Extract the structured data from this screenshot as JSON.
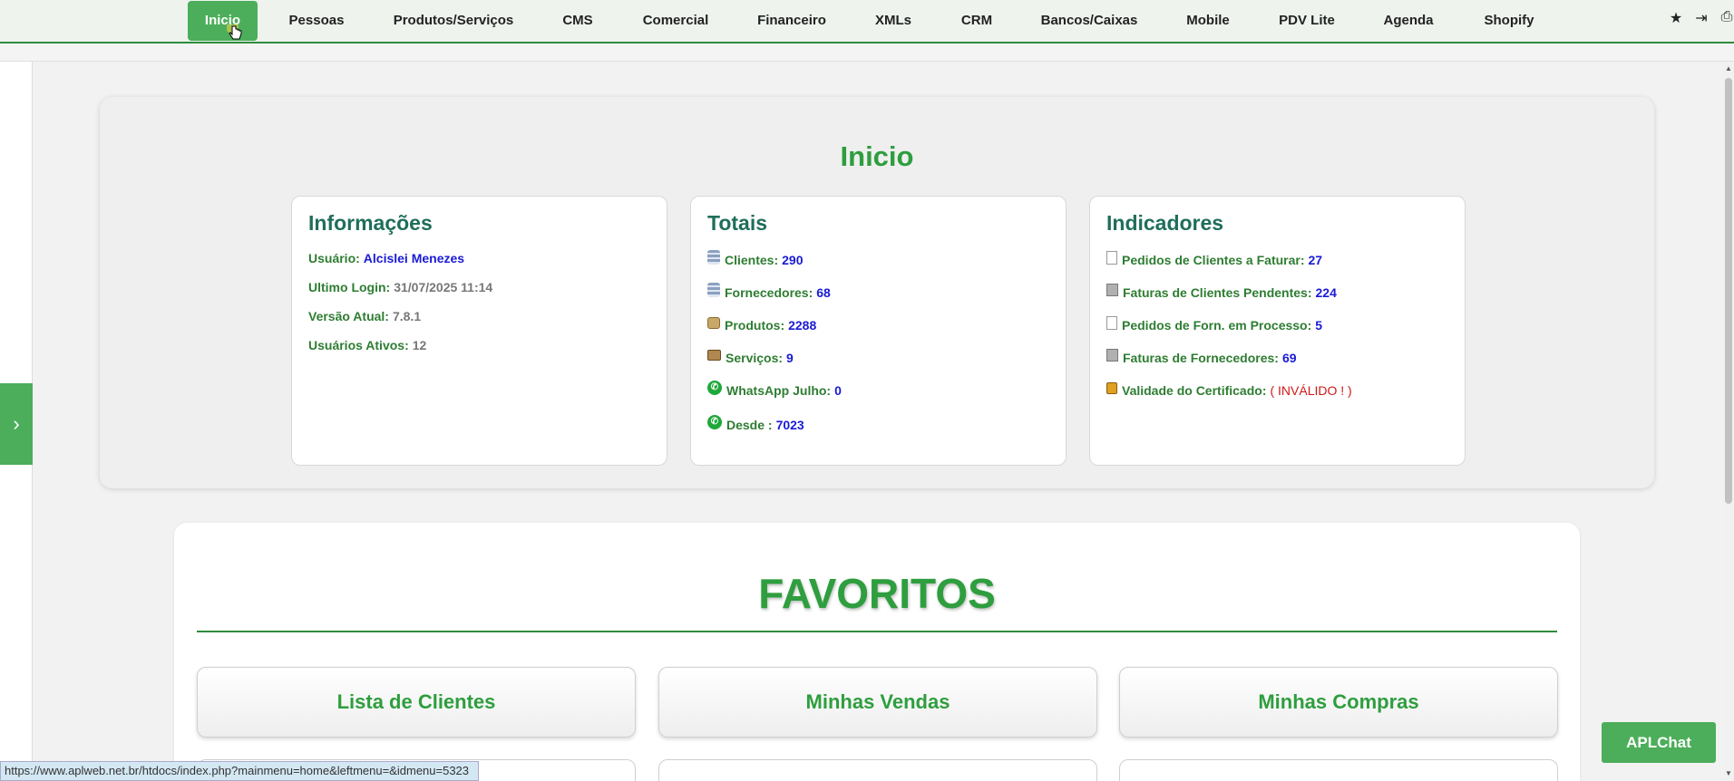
{
  "nav": {
    "items": [
      {
        "label": "Inicio",
        "active": true
      },
      {
        "label": "Pessoas"
      },
      {
        "label": "Produtos/Serviços"
      },
      {
        "label": "CMS"
      },
      {
        "label": "Comercial"
      },
      {
        "label": "Financeiro"
      },
      {
        "label": "XMLs"
      },
      {
        "label": "CRM"
      },
      {
        "label": "Bancos/Caixas"
      },
      {
        "label": "Mobile"
      },
      {
        "label": "PDV Lite"
      },
      {
        "label": "Agenda"
      },
      {
        "label": "Shopify"
      }
    ],
    "icons": [
      "star-icon",
      "logout-icon",
      "print-icon"
    ]
  },
  "inicio": {
    "title": "Inicio",
    "informacoes": {
      "heading": "Informações",
      "usuario_label": "Usuário:",
      "usuario_value": "Alcislei Menezes",
      "login_label": "Ultimo Login:",
      "login_value": "31/07/2025 11:14",
      "versao_label": "Versão Atual:",
      "versao_value": "7.8.1",
      "ativos_label": "Usuários Ativos:",
      "ativos_value": "12"
    },
    "totais": {
      "heading": "Totais",
      "clientes_label": "Clientes:",
      "clientes_value": "290",
      "fornecedores_label": "Fornecedores:",
      "fornecedores_value": "68",
      "produtos_label": "Produtos:",
      "produtos_value": "2288",
      "servicos_label": "Serviços:",
      "servicos_value": "9",
      "whatsapp_label": "WhatsApp Julho:",
      "whatsapp_value": "0",
      "desde_label": "Desde :",
      "desde_value": "7023"
    },
    "indicadores": {
      "heading": "Indicadores",
      "pedidos_label": "Pedidos de Clientes a Faturar:",
      "pedidos_value": "27",
      "faturas_label": "Faturas de Clientes Pendentes:",
      "faturas_value": "224",
      "pedforn_label": "Pedidos de Forn. em Processo:",
      "pedforn_value": "5",
      "fatforn_label": "Faturas de Fornecedores:",
      "fatforn_value": "69",
      "cert_label": "Validade do Certificado:",
      "cert_value": "( INVÁLIDO ! )"
    }
  },
  "favoritos": {
    "title": "FAVORITOS",
    "buttons": [
      "Lista de Clientes",
      "Minhas Vendas",
      "Minhas Compras"
    ]
  },
  "status_url": "https://www.aplweb.net.br/htdocs/index.php?mainmenu=home&leftmenu=&idmenu=5323",
  "chat_label": "APLChat",
  "colors": {
    "accent": "#4cae5a",
    "heading": "#2e9e3e",
    "value_blue": "#1a1ad6",
    "invalid_red": "#d01818"
  }
}
